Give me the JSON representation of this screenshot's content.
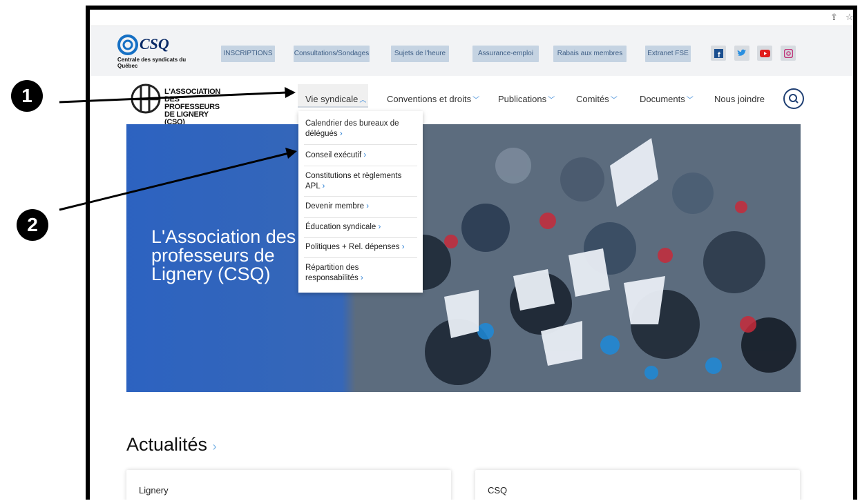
{
  "annotations": {
    "badge_1": "1",
    "badge_2": "2"
  },
  "topbar": {
    "csq_word": "CSQ",
    "csq_subtitle": "Centrale des syndicats du Québec",
    "links": [
      "INSCRIPTIONS",
      "Consultations/Sondages",
      "Sujets de l'heure",
      "Assurance-emploi",
      "Rabais aux membres",
      "Extranet FSE"
    ],
    "social": [
      "facebook-icon",
      "twitter-icon",
      "youtube-icon",
      "instagram-icon"
    ]
  },
  "nav": {
    "logo_text_line1": "L'ASSOCIATION",
    "logo_text_line2": "DES PROFESSEURS",
    "logo_text_line3": "DE LIGNERY (CSQ)",
    "items": [
      "Vie syndicale",
      "Conventions et droits",
      "Publications",
      "Comités",
      "Documents",
      "Nous joindre"
    ]
  },
  "dropdown": {
    "items": [
      "Calendrier des bureaux de délégués",
      "Conseil exécutif",
      "Constitutions et règlements APL",
      "Devenir membre",
      "Éducation syndicale",
      "Politiques + Rel. dépenses",
      "Répartition des responsabilités"
    ]
  },
  "hero": {
    "title": "L'Association des professeurs de Lignery (CSQ)"
  },
  "news": {
    "title": "Actualités",
    "cards": [
      "Lignery",
      "CSQ"
    ]
  },
  "colors": {
    "navy": "#0a2a66",
    "accent_blue": "#2a7fd4",
    "link_bg": "#c5d3e2"
  }
}
